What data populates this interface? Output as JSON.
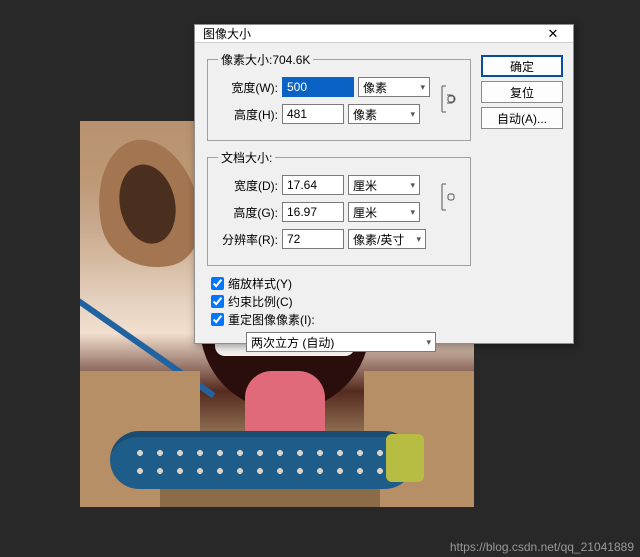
{
  "dialog": {
    "title": "图像大小",
    "pixel_group_legend": "像素大小:704.6K",
    "doc_group_legend": "文档大小:",
    "labels": {
      "width_px": "宽度(W):",
      "height_px": "高度(H):",
      "width_doc": "宽度(D):",
      "height_doc": "高度(G):",
      "resolution": "分辨率(R):"
    },
    "values": {
      "width_px": "500",
      "height_px": "481",
      "width_doc": "17.64",
      "height_doc": "16.97",
      "resolution": "72"
    },
    "units": {
      "px1": "像素",
      "px2": "像素",
      "cm1": "厘米",
      "cm2": "厘米",
      "res": "像素/英寸"
    },
    "checks": {
      "scale_styles": "缩放样式(Y)",
      "constrain": "约束比例(C)",
      "resample": "重定图像像素(I):"
    },
    "resample_method": "两次立方 (自动)"
  },
  "buttons": {
    "ok": "确定",
    "reset": "复位",
    "auto": "自动(A)..."
  },
  "watermark": "https://blog.csdn.net/qq_21041889"
}
